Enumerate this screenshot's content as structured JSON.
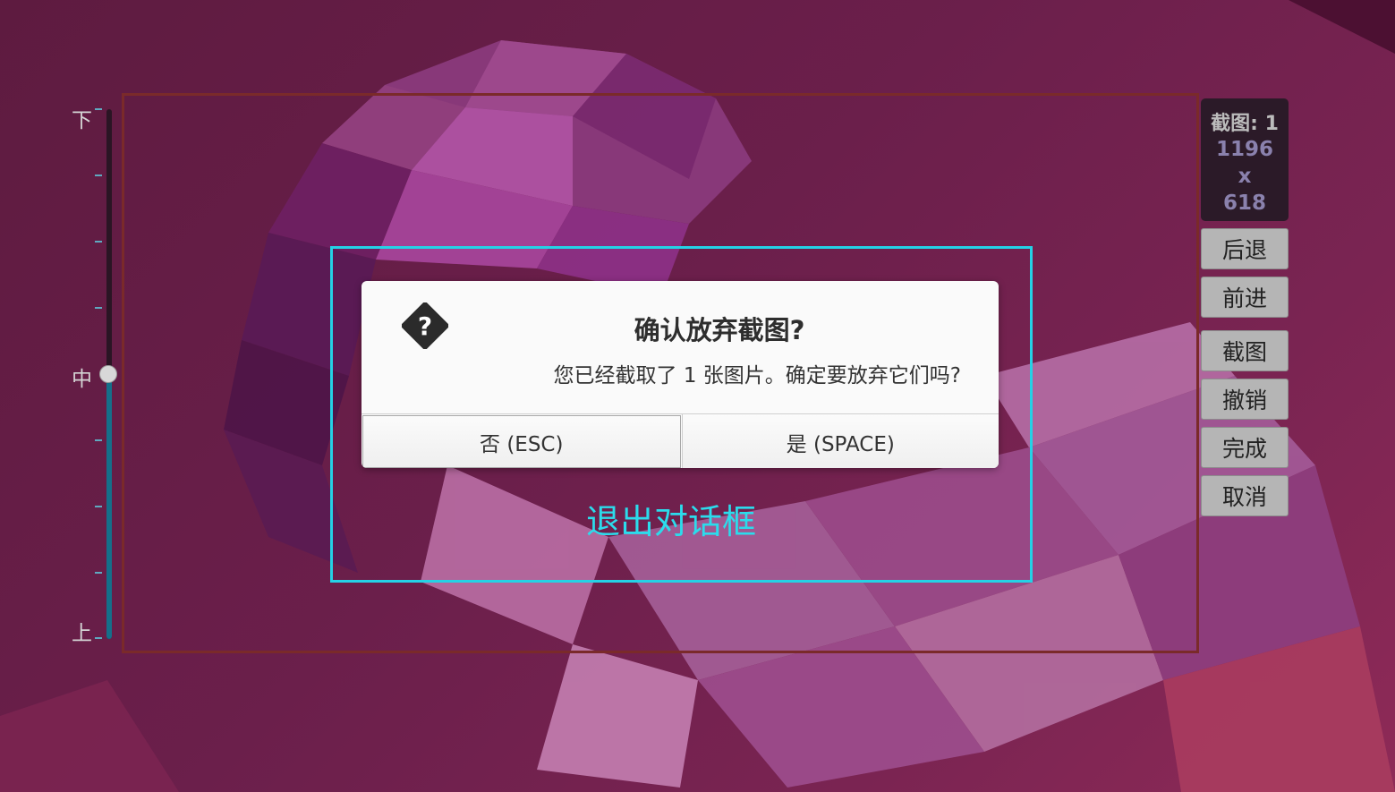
{
  "slider": {
    "label_top": "下",
    "label_middle": "中",
    "label_bottom": "上",
    "value_fraction_from_bottom": 0.5,
    "track_color": "#2a1524",
    "fill_color": "#156f8a"
  },
  "dialog": {
    "icon": "question-diamond-icon",
    "title": "确认放弃截图?",
    "message": "您已经截取了 1 张图片。确定要放弃它们吗?",
    "no_button": "否 (ESC)",
    "yes_button": "是 (SPACE)"
  },
  "overlay": {
    "exit_label": "退出对话框",
    "accent_color": "#24d2e6",
    "selection_color": "#7a2a2a"
  },
  "toolbar": {
    "info": {
      "title": "截图: 1",
      "width": "1196",
      "separator": "x",
      "height": "618"
    },
    "back": "后退",
    "forward": "前进",
    "capture": "截图",
    "undo": "撤销",
    "done": "完成",
    "cancel": "取消"
  }
}
